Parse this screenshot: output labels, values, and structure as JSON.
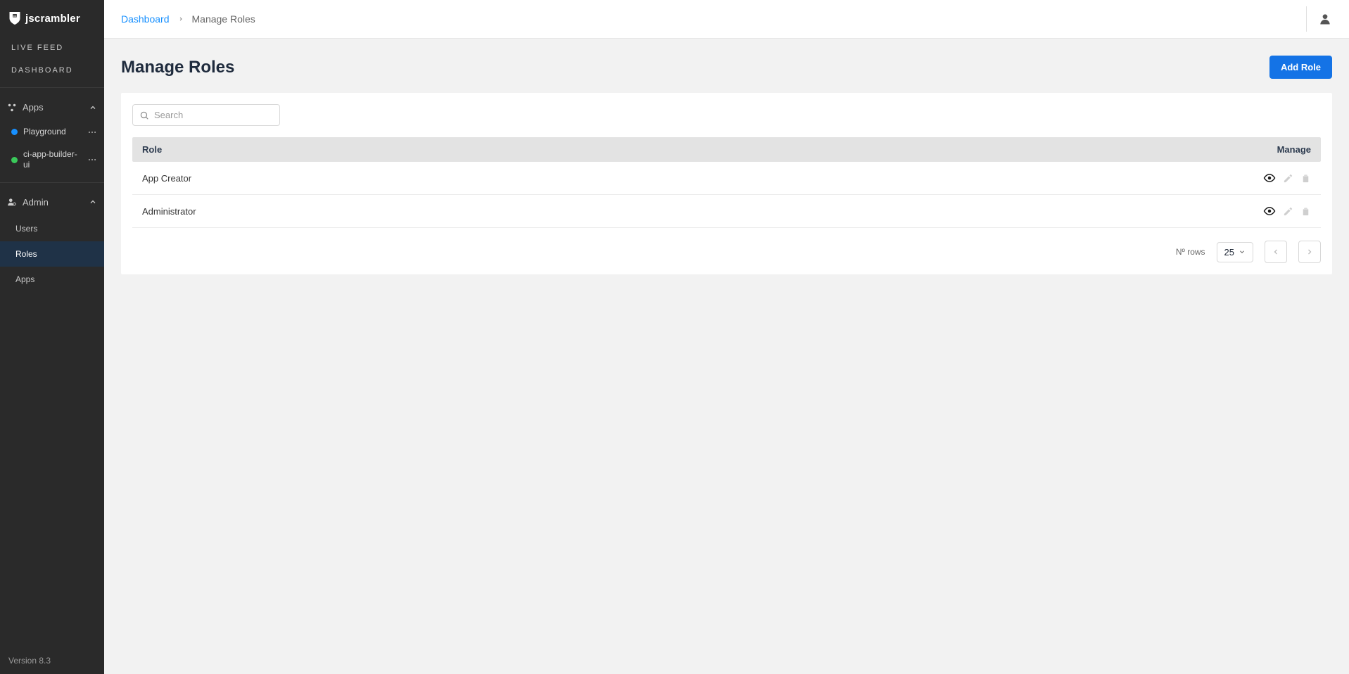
{
  "brand": {
    "name": "jscrambler"
  },
  "sidebar": {
    "live_feed": "LIVE FEED",
    "dashboard": "DASHBOARD",
    "apps_label": "Apps",
    "apps": [
      {
        "name": "Playground",
        "dot": "dot-blue"
      },
      {
        "name": "ci-app-builder-ui",
        "dot": "dot-green"
      }
    ],
    "admin_label": "Admin",
    "admin_items": [
      "Users",
      "Roles",
      "Apps"
    ],
    "version": "Version 8.3"
  },
  "breadcrumb": {
    "root": "Dashboard",
    "current": "Manage Roles"
  },
  "page": {
    "title": "Manage Roles",
    "add_role": "Add Role",
    "search_placeholder": "Search"
  },
  "table": {
    "header_role": "Role",
    "header_manage": "Manage",
    "rows": [
      {
        "name": "App Creator"
      },
      {
        "name": "Administrator"
      }
    ],
    "rows_label": "Nº rows",
    "rows_per_page": "25"
  }
}
